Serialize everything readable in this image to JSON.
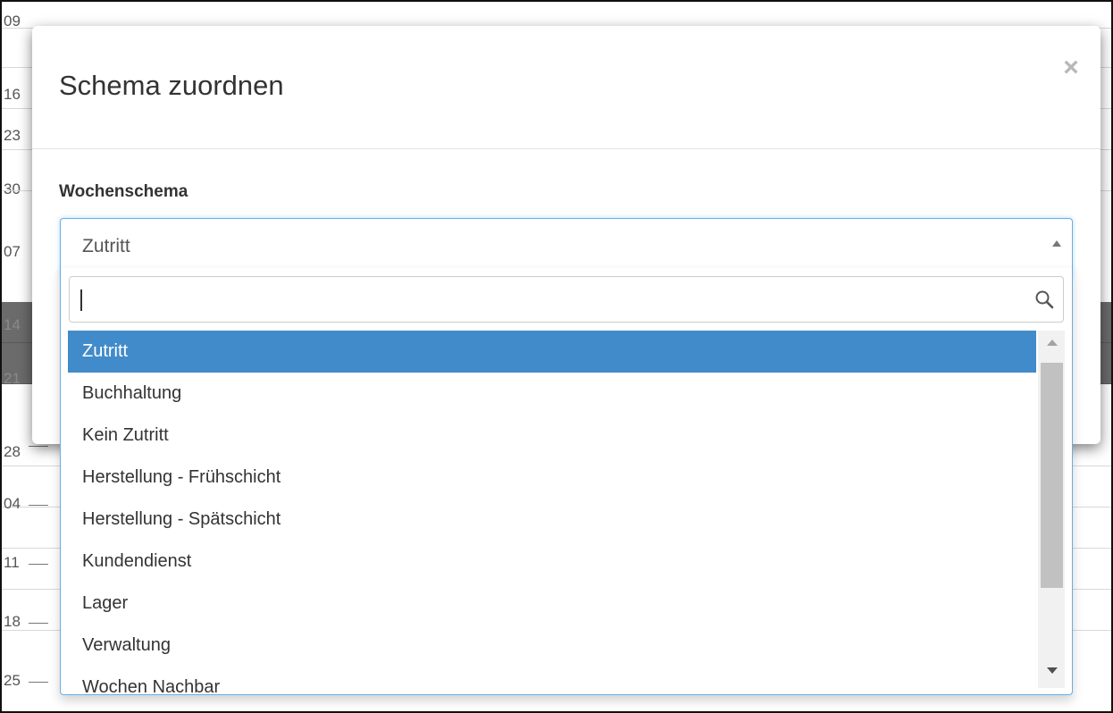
{
  "background": {
    "row_dates": [
      "09",
      "16",
      "23",
      "30",
      "07",
      "14",
      "21",
      "28",
      "04",
      "11",
      "18",
      "25"
    ]
  },
  "modal": {
    "title": "Schema zuordnen",
    "close_label": "×",
    "field_label": "Wochenschema",
    "select": {
      "value": "Zutritt",
      "search_placeholder": "",
      "options": [
        {
          "label": "Zutritt",
          "selected": true
        },
        {
          "label": "Buchhaltung",
          "selected": false
        },
        {
          "label": "Kein Zutritt",
          "selected": false
        },
        {
          "label": "Herstellung - Frühschicht",
          "selected": false
        },
        {
          "label": "Herstellung - Spätschicht",
          "selected": false
        },
        {
          "label": "Kundendienst",
          "selected": false
        },
        {
          "label": "Lager",
          "selected": false
        },
        {
          "label": "Verwaltung",
          "selected": false
        },
        {
          "label": "Wochen Nachbar",
          "selected": false
        }
      ]
    }
  },
  "colors": {
    "selected_option_bg": "#428bca",
    "focus_border": "#66afe9"
  },
  "icons": {
    "close": "close-icon",
    "search": "search-icon",
    "caret": "caret-up-icon"
  }
}
